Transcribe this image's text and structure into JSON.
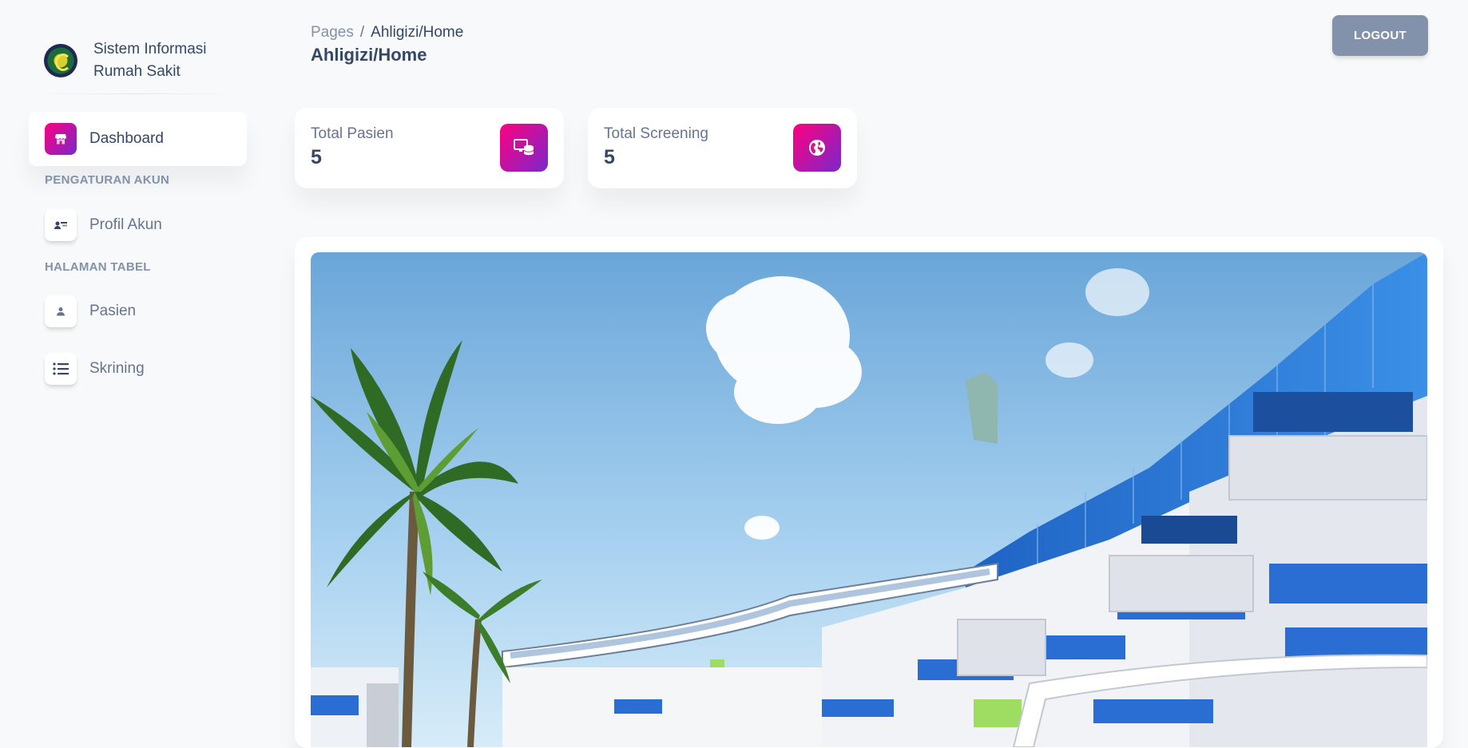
{
  "brand": {
    "line1": "Sistem Informasi",
    "line2": "Rumah Sakit",
    "logo_icon": "hospital-seal-logo"
  },
  "sidebar": {
    "dashboard_label": "Dashboard",
    "section_account": "PENGATURAN AKUN",
    "profile_label": "Profil Akun",
    "section_tables": "HALAMAN TABEL",
    "pasien_label": "Pasien",
    "skrining_label": "Skrining",
    "icons": {
      "dashboard": "shop-icon",
      "profile": "id-card-icon",
      "pasien": "user-icon",
      "skrining": "list-icon"
    }
  },
  "header": {
    "breadcrumb_root": "Pages",
    "breadcrumb_separator": "/",
    "breadcrumb_current": "Ahligizi/Home",
    "title": "Ahligizi/Home",
    "logout_label": "LOGOUT"
  },
  "stats": {
    "pasien": {
      "label": "Total Pasien",
      "value": "5",
      "icon": "screen-database-icon"
    },
    "screening": {
      "label": "Total Screening",
      "value": "5",
      "icon": "globe-icon"
    }
  },
  "colors": {
    "accent_start": "#7928ca",
    "accent_end": "#ff0080",
    "logout_bg": "#8392ab",
    "text_dark": "#344767",
    "text_muted": "#67748e"
  }
}
